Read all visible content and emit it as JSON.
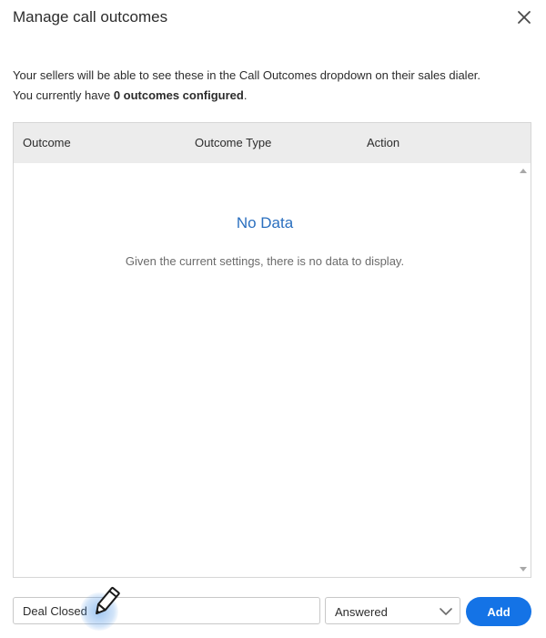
{
  "dialog": {
    "title": "Manage call outcomes",
    "description_line1": "Your sellers will be able to see these in the Call Outcomes dropdown on their sales dialer.",
    "description_line2_prefix": "You currently have ",
    "description_line2_bold": "0 outcomes configured",
    "description_line2_suffix": "."
  },
  "table": {
    "columns": [
      "Outcome",
      "Outcome Type",
      "Action"
    ],
    "empty_title": "No Data",
    "empty_message": "Given the current settings, there is no data to display."
  },
  "form": {
    "outcome_value": "Deal Closed",
    "type_selected": "Answered",
    "add_label": "Add"
  },
  "icons": {
    "close": "close-icon",
    "chevron": "chevron-down-icon",
    "cursor": "pencil-cursor-icon"
  },
  "colors": {
    "accent": "#1473e6",
    "empty_title": "#2a6fbf",
    "header_bg": "#ececec"
  }
}
